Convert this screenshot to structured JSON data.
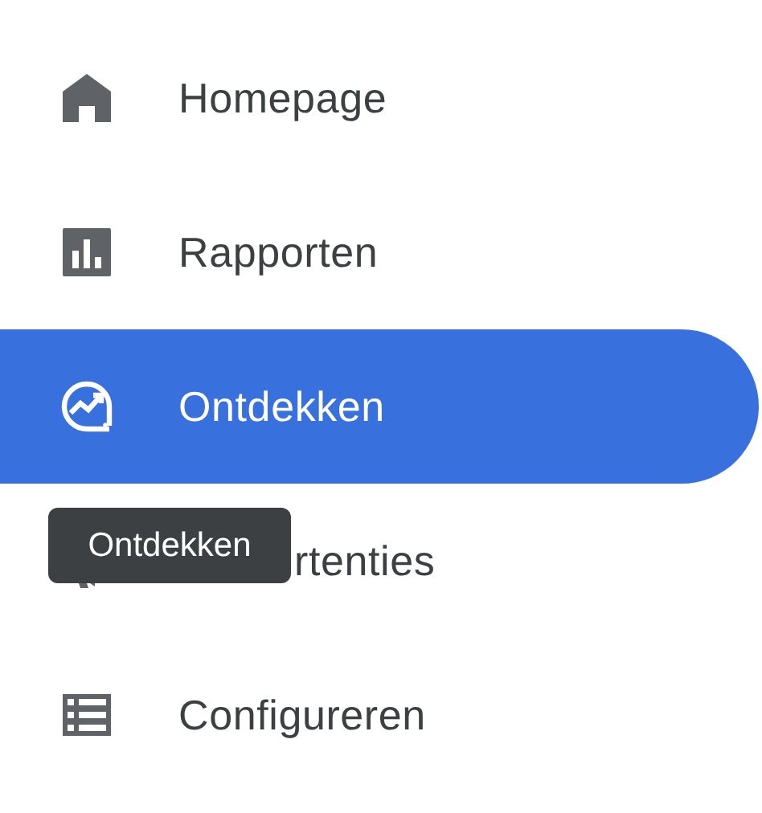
{
  "nav_items": [
    {
      "label": "Homepage",
      "selected": false,
      "covered": false
    },
    {
      "label": "Rapporten",
      "selected": false,
      "covered": false
    },
    {
      "label": "Ontdekken",
      "selected": true,
      "covered": false
    },
    {
      "label": "rtenties",
      "selected": false,
      "covered": true
    },
    {
      "label": "Configureren",
      "selected": false,
      "covered": false
    }
  ],
  "tooltip": {
    "text": "Ontdekken"
  }
}
